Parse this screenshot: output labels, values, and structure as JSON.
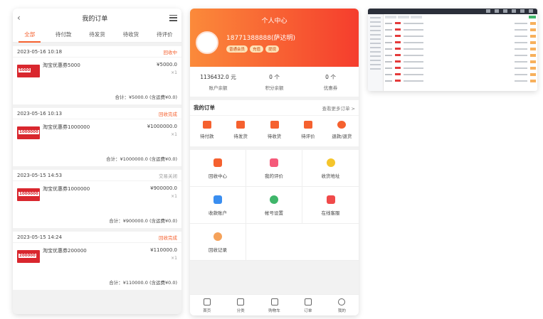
{
  "orders": {
    "title": "我的订单",
    "tabs": [
      "全部",
      "待付款",
      "待发货",
      "待收货",
      "待评价"
    ],
    "list": [
      {
        "date": "2023-05-16 10:18",
        "status": "回收中",
        "coupon": "5000",
        "name": "淘宝优惠券5000",
        "price": "¥5000.0",
        "qty": "×1",
        "total": "合计：¥5000.0 (含运费¥0.0)"
      },
      {
        "date": "2023-05-16 10:13",
        "status": "回收完成",
        "coupon": "1000000",
        "name": "淘宝优惠券1000000",
        "price": "¥1000000.0",
        "qty": "×1",
        "total": "合计：¥1000000.0 (含运费¥0.0)"
      },
      {
        "date": "2023-05-15 14:53",
        "status": "交易关闭",
        "coupon": "1000000",
        "name": "淘宝优惠券1000000",
        "price": "¥900000.0",
        "qty": "×1",
        "total": "合计：¥900000.0 (含运费¥0.0)"
      },
      {
        "date": "2023-05-15 14:24",
        "status": "回收完成",
        "coupon": "200000",
        "name": "淘宝优惠券200000",
        "price": "¥110000.0",
        "qty": "×1",
        "total": "合计：¥110000.0 (含运费¥0.0)"
      }
    ]
  },
  "profile": {
    "title": "个人中心",
    "phone": "18771388888(萨达明)",
    "badges": [
      "普通会员",
      "充值",
      "提现"
    ],
    "stats": [
      {
        "value": "1136432.0 元",
        "label": "账户余额"
      },
      {
        "value": "0 个",
        "label": "积分余额"
      },
      {
        "value": "0 个",
        "label": "优惠券"
      }
    ],
    "myorder": {
      "title": "我的订单",
      "more": "查看更多订单 >"
    },
    "order_icons": [
      {
        "label": "待付款",
        "color": "#f5612f"
      },
      {
        "label": "待发货",
        "color": "#f5612f"
      },
      {
        "label": "待收货",
        "color": "#f5612f"
      },
      {
        "label": "待评价",
        "color": "#f5612f"
      },
      {
        "label": "退款/退货",
        "color": "#f5612f"
      }
    ],
    "grid": [
      {
        "label": "回收中心",
        "color": "#f5612f"
      },
      {
        "label": "我的评价",
        "color": "#f55a7a"
      },
      {
        "label": "收货地址",
        "color": "#f5c52b"
      },
      {
        "label": "收款账户",
        "color": "#3a8ef0"
      },
      {
        "label": "帐号设置",
        "color": "#3fb66a"
      },
      {
        "label": "在线客服",
        "color": "#f04a4a"
      },
      {
        "label": "回收记录",
        "color": "#f5a25a"
      }
    ],
    "tabbar": [
      "首页",
      "分类",
      "购物车",
      "订单",
      "我的"
    ]
  }
}
